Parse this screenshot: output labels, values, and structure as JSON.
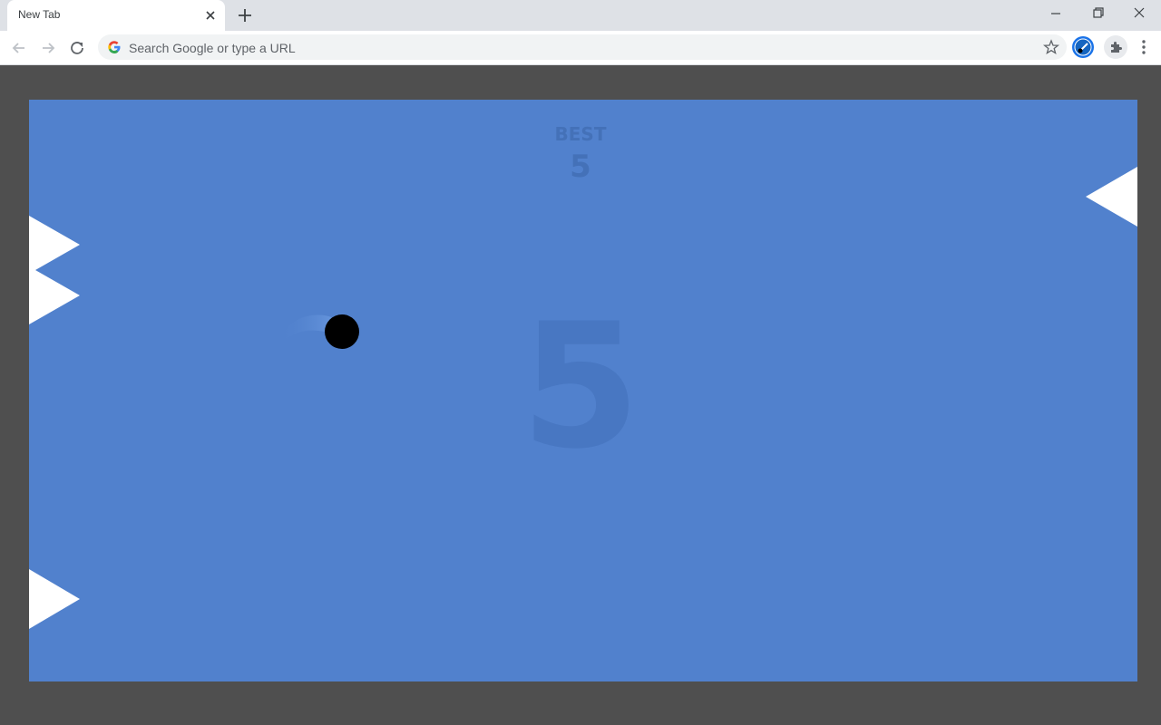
{
  "browser": {
    "tab_title": "New Tab",
    "omnibox_placeholder": "Search Google or type a URL"
  },
  "game": {
    "best_label": "BEST",
    "best_value": "5",
    "score": "5",
    "colors": {
      "background": "#5181cd",
      "frame": "#4f4f4f",
      "spike": "#ffffff",
      "ball": "#000000"
    },
    "spikes_left_count": 3,
    "spikes_right_count": 1
  }
}
